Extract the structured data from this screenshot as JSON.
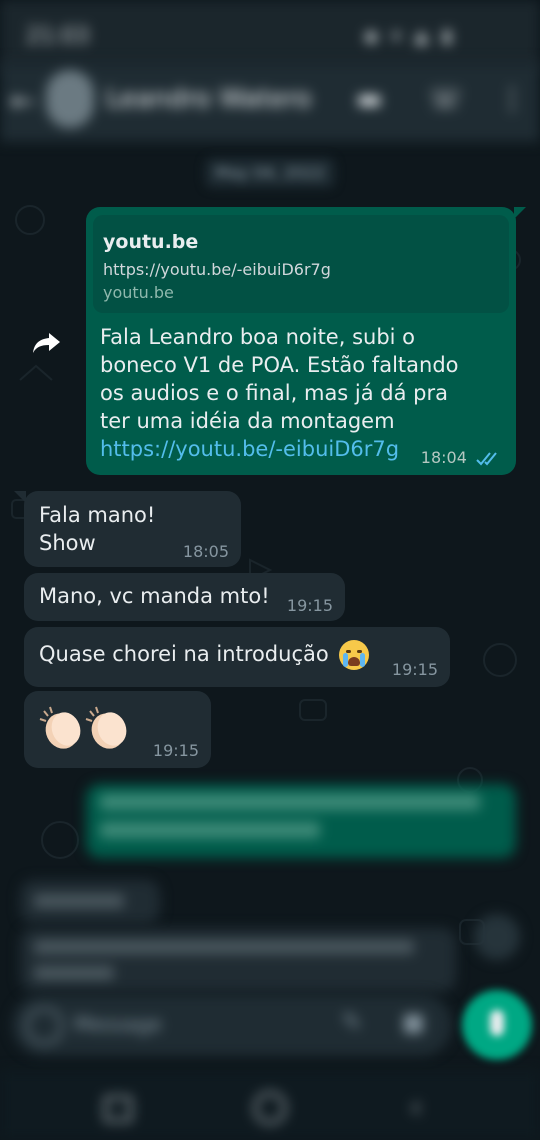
{
  "colors": {
    "outgoing_bubble": "#005c4b",
    "incoming_bubble": "#202c33",
    "link": "#53bdeb",
    "read_ticks": "#53bdeb",
    "accent_green": "#00a884"
  },
  "header": {
    "contact_name": "Leandro Watero",
    "icons": [
      "back-arrow-icon",
      "video-call-icon",
      "phone-icon",
      "more-vert-icon"
    ]
  },
  "messages": {
    "m1": {
      "direction": "outgoing",
      "preview_title": "youtu.be",
      "preview_desc": "https://youtu.be/-eibuiD6r7g",
      "preview_domain": "youtu.be",
      "text": "Fala Leandro boa noite, subi o boneco V1 de POA. Estão faltando os audios e o final, mas já dá pra ter uma idéia da montagem",
      "link": "https://youtu.be/-eibuiD6r7g",
      "time": "18:04",
      "status": "read"
    },
    "m2": {
      "direction": "incoming",
      "line1": "Fala mano!",
      "line2": "Show",
      "time": "18:05"
    },
    "m3": {
      "direction": "incoming",
      "text": "Mano, vc manda mto!",
      "time": "19:15"
    },
    "m4": {
      "direction": "incoming",
      "text": "Quase chorei na introdução",
      "emoji": "loudly-crying-face",
      "time": "19:15"
    },
    "m5": {
      "direction": "incoming",
      "emoji": "clapping-hands x2",
      "time": "19:15"
    }
  }
}
